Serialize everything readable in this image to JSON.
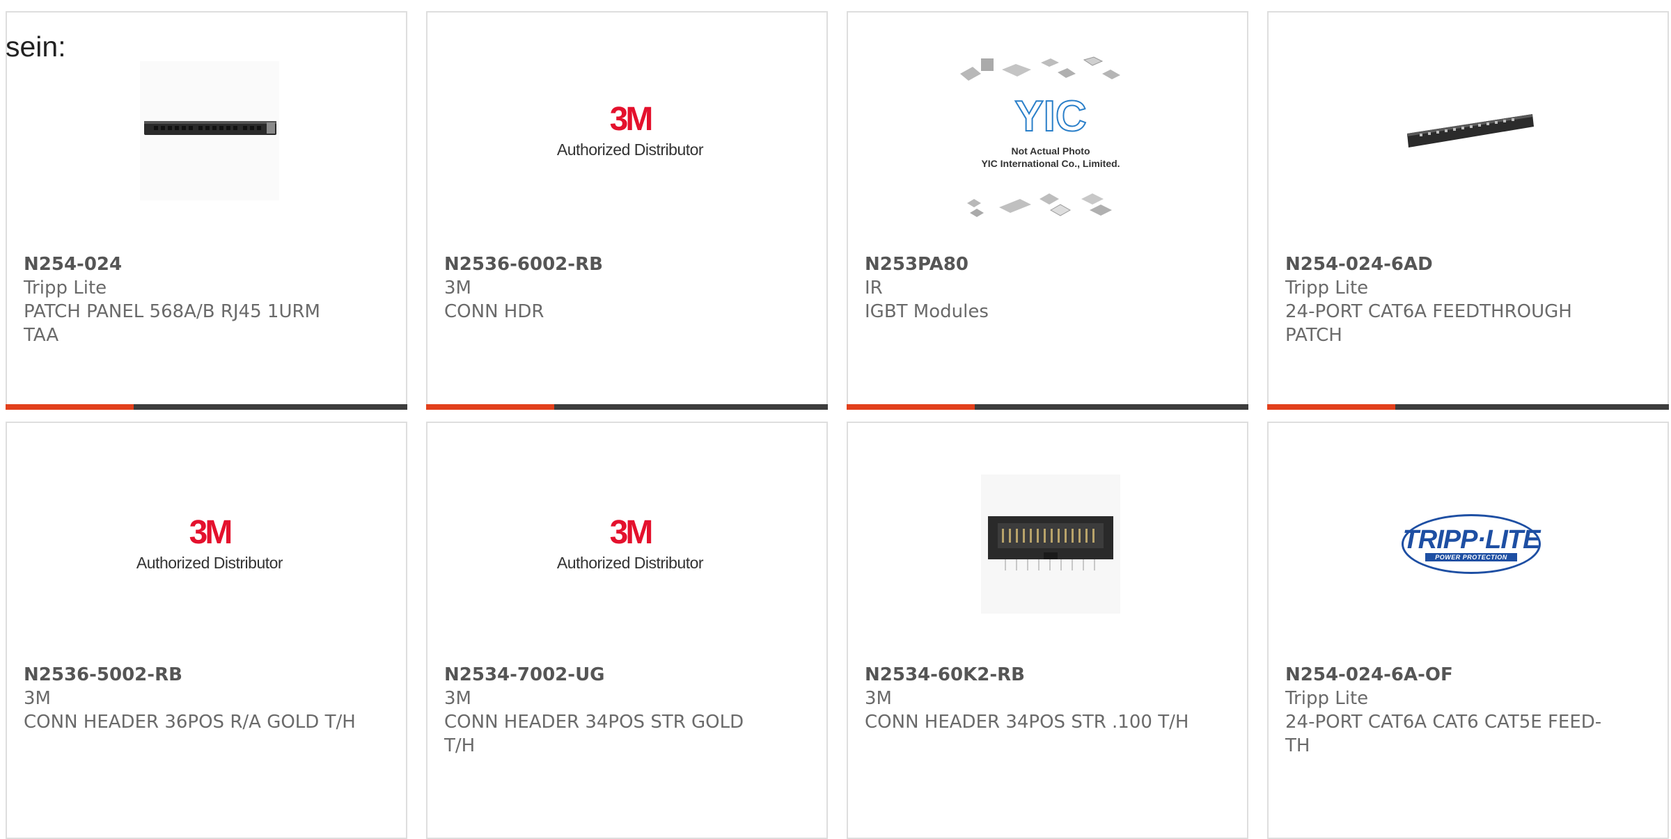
{
  "page": {
    "lead_text": "sein:"
  },
  "logos": {
    "m3_mark": "3M",
    "m3_sub": "Authorized Distributor",
    "tripp_name": "TRIPP·LITE",
    "tripp_tagline": "POWER PROTECTION",
    "yic_mark": "YIC",
    "yic_caption_1": "Not Actual Photo",
    "yic_caption_2": "YIC International Co., Limited."
  },
  "products": [
    {
      "part": "N254-024",
      "mfr": "Tripp Lite",
      "desc": "PATCH PANEL 568A/B RJ45 1URM TAA",
      "image": "patch-panel-photo"
    },
    {
      "part": "N2536-6002-RB",
      "mfr": "3M",
      "desc": "CONN HDR",
      "image": "3m-logo"
    },
    {
      "part": "N253PA80",
      "mfr": "IR",
      "desc": "IGBT Modules",
      "image": "yic-placeholder"
    },
    {
      "part": "N254-024-6AD",
      "mfr": "Tripp Lite",
      "desc": "24-PORT CAT6A FEEDTHROUGH PATCH",
      "image": "patch-panel-photo"
    },
    {
      "part": "N2536-5002-RB",
      "mfr": "3M",
      "desc": "CONN HEADER 36POS R/A GOLD T/H",
      "image": "3m-logo"
    },
    {
      "part": "N2534-7002-UG",
      "mfr": "3M",
      "desc": "CONN HEADER 34POS STR GOLD T/H",
      "image": "3m-logo"
    },
    {
      "part": "N2534-60K2-RB",
      "mfr": "3M",
      "desc": "CONN HEADER 34POS STR .100 T/H",
      "image": "header-connector-photo"
    },
    {
      "part": "N254-024-6A-OF",
      "mfr": "Tripp Lite",
      "desc": "24-PORT CAT6A CAT6 CAT5E FEED-TH",
      "image": "tripp-lite-logo"
    }
  ],
  "colors": {
    "accent": "#e2401c",
    "bar": "#3d3d3d",
    "border": "#dedede"
  }
}
